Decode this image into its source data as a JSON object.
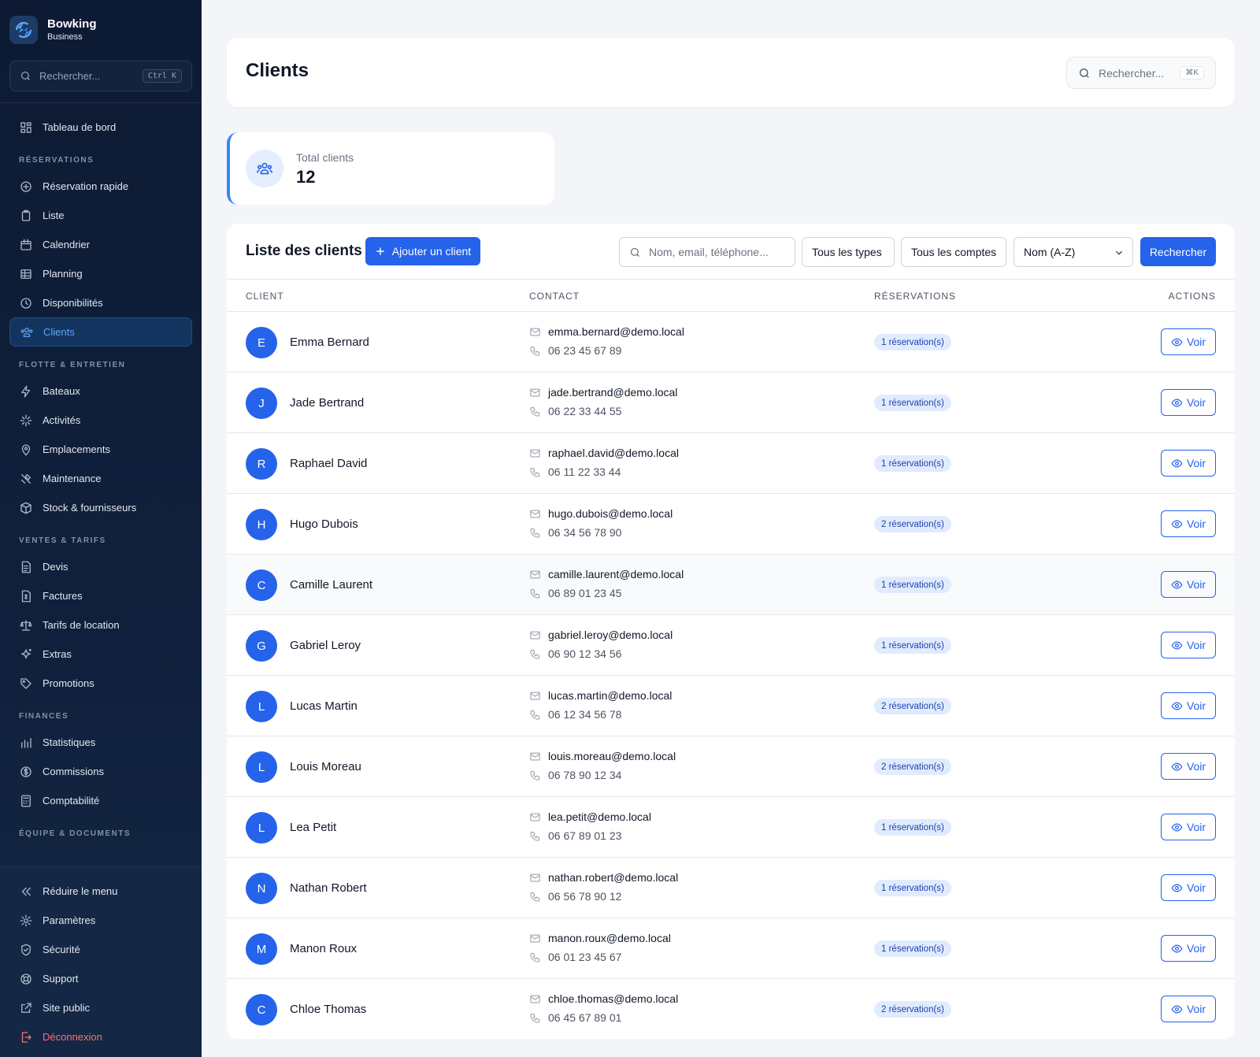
{
  "brand": {
    "name": "Bowking",
    "subtitle": "Business"
  },
  "sidebar": {
    "search_placeholder": "Rechercher...",
    "search_shortcut": "Ctrl K",
    "dashboard": {
      "label": "Tableau de bord",
      "icon": "dashboard-icon"
    },
    "sections": [
      {
        "title": "RÉSERVATIONS",
        "items": [
          {
            "label": "Réservation rapide",
            "icon": "plus-circle-icon"
          },
          {
            "label": "Liste",
            "icon": "clipboard-icon"
          },
          {
            "label": "Calendrier",
            "icon": "calendar-icon"
          },
          {
            "label": "Planning",
            "icon": "table-icon"
          },
          {
            "label": "Disponibilités",
            "icon": "clock-icon"
          },
          {
            "label": "Clients",
            "icon": "users-icon",
            "active": true
          }
        ]
      },
      {
        "title": "FLOTTE & ENTRETIEN",
        "items": [
          {
            "label": "Bateaux",
            "icon": "bolt-icon"
          },
          {
            "label": "Activités",
            "icon": "sparkle-icon"
          },
          {
            "label": "Emplacements",
            "icon": "map-pin-icon"
          },
          {
            "label": "Maintenance",
            "icon": "tools-icon"
          },
          {
            "label": "Stock & fournisseurs",
            "icon": "box-icon"
          }
        ]
      },
      {
        "title": "VENTES & TARIFS",
        "items": [
          {
            "label": "Devis",
            "icon": "document-icon"
          },
          {
            "label": "Factures",
            "icon": "invoice-icon"
          },
          {
            "label": "Tarifs de location",
            "icon": "scale-icon"
          },
          {
            "label": "Extras",
            "icon": "stars-icon"
          },
          {
            "label": "Promotions",
            "icon": "tag-icon"
          }
        ]
      },
      {
        "title": "FINANCES",
        "items": [
          {
            "label": "Statistiques",
            "icon": "bar-chart-icon"
          },
          {
            "label": "Commissions",
            "icon": "dollar-circle-icon"
          },
          {
            "label": "Comptabilité",
            "icon": "calculator-icon"
          }
        ]
      },
      {
        "title": "ÉQUIPE & DOCUMENTS",
        "items": []
      }
    ],
    "bottom": [
      {
        "label": "Réduire le menu",
        "icon": "chevrons-left-icon"
      },
      {
        "label": "Paramètres",
        "icon": "gear-icon"
      },
      {
        "label": "Sécurité",
        "icon": "shield-icon"
      },
      {
        "label": "Support",
        "icon": "lifebuoy-icon"
      },
      {
        "label": "Site public",
        "icon": "external-link-icon"
      },
      {
        "label": "Déconnexion",
        "icon": "logout-icon",
        "danger": true
      }
    ]
  },
  "header": {
    "title": "Clients",
    "search_placeholder": "Rechercher...",
    "shortcut": "⌘K"
  },
  "stats": {
    "label": "Total clients",
    "value": "12"
  },
  "list": {
    "title": "Liste des clients",
    "add_label": "Ajouter un client",
    "search_placeholder": "Nom, email, téléphone...",
    "type_filter": "Tous les types",
    "account_filter": "Tous les comptes",
    "sort": "Nom (A-Z)",
    "search_button": "Rechercher",
    "columns": [
      "CLIENT",
      "CONTACT",
      "RÉSERVATIONS",
      "ACTIONS"
    ],
    "view_label": "Voir",
    "rows": [
      {
        "initial": "E",
        "name": "Emma Bernard",
        "email": "emma.bernard@demo.local",
        "phone": "06 23 45 67 89",
        "reservations": "1 réservation(s)"
      },
      {
        "initial": "J",
        "name": "Jade Bertrand",
        "email": "jade.bertrand@demo.local",
        "phone": "06 22 33 44 55",
        "reservations": "1 réservation(s)"
      },
      {
        "initial": "R",
        "name": "Raphael David",
        "email": "raphael.david@demo.local",
        "phone": "06 11 22 33 44",
        "reservations": "1 réservation(s)"
      },
      {
        "initial": "H",
        "name": "Hugo Dubois",
        "email": "hugo.dubois@demo.local",
        "phone": "06 34 56 78 90",
        "reservations": "2 réservation(s)"
      },
      {
        "initial": "C",
        "name": "Camille Laurent",
        "email": "camille.laurent@demo.local",
        "phone": "06 89 01 23 45",
        "reservations": "1 réservation(s)"
      },
      {
        "initial": "G",
        "name": "Gabriel Leroy",
        "email": "gabriel.leroy@demo.local",
        "phone": "06 90 12 34 56",
        "reservations": "1 réservation(s)"
      },
      {
        "initial": "L",
        "name": "Lucas Martin",
        "email": "lucas.martin@demo.local",
        "phone": "06 12 34 56 78",
        "reservations": "2 réservation(s)"
      },
      {
        "initial": "L",
        "name": "Louis Moreau",
        "email": "louis.moreau@demo.local",
        "phone": "06 78 90 12 34",
        "reservations": "2 réservation(s)"
      },
      {
        "initial": "L",
        "name": "Lea Petit",
        "email": "lea.petit@demo.local",
        "phone": "06 67 89 01 23",
        "reservations": "1 réservation(s)"
      },
      {
        "initial": "N",
        "name": "Nathan Robert",
        "email": "nathan.robert@demo.local",
        "phone": "06 56 78 90 12",
        "reservations": "1 réservation(s)"
      },
      {
        "initial": "M",
        "name": "Manon Roux",
        "email": "manon.roux@demo.local",
        "phone": "06 01 23 45 67",
        "reservations": "1 réservation(s)"
      },
      {
        "initial": "C",
        "name": "Chloe Thomas",
        "email": "chloe.thomas@demo.local",
        "phone": "06 45 67 89 01",
        "reservations": "2 réservation(s)"
      }
    ]
  },
  "colors": {
    "accent": "#2563eb",
    "sidebar_bg": "#0d1a33",
    "page_bg": "#f3f5f8",
    "danger": "#f87171"
  }
}
